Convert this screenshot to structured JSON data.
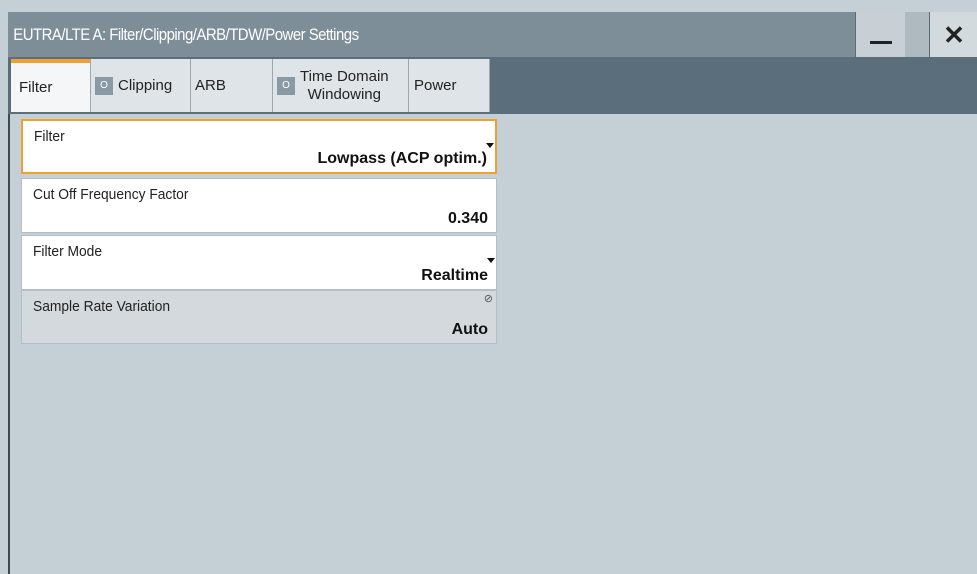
{
  "window": {
    "title": "EUTRA/LTE A: Filter/Clipping/ARB/TDW/Power Settings",
    "minimize_glyph": "—",
    "close_glyph": "✕"
  },
  "tabs": [
    {
      "label": "Filter",
      "active": true,
      "has_led": false
    },
    {
      "label": "Clipping",
      "active": false,
      "has_led": true,
      "led_text": "O"
    },
    {
      "label": "ARB",
      "active": false,
      "has_led": false
    },
    {
      "label_line1": "Time Domain",
      "label_line2": "Windowing",
      "active": false,
      "has_led": true,
      "led_text": "O"
    },
    {
      "label": "Power",
      "active": false,
      "has_led": false
    }
  ],
  "fields": {
    "filter": {
      "label": "Filter",
      "value": "Lowpass (ACP optim.)",
      "type": "dropdown",
      "focused": true
    },
    "cutoff": {
      "label": "Cut Off Frequency Factor",
      "value": "0.340",
      "type": "number"
    },
    "filter_mode": {
      "label": "Filter Mode",
      "value": "Realtime",
      "type": "dropdown"
    },
    "sample_rate_variation": {
      "label": "Sample Rate Variation",
      "value": "Auto",
      "type": "readonly",
      "disabled_icon": "⊘"
    }
  },
  "colors": {
    "accent": "#f0a030",
    "titlebar": "#7e8e99",
    "tabstrip": "#5a6e7b",
    "panel": "#c5cfd6"
  }
}
